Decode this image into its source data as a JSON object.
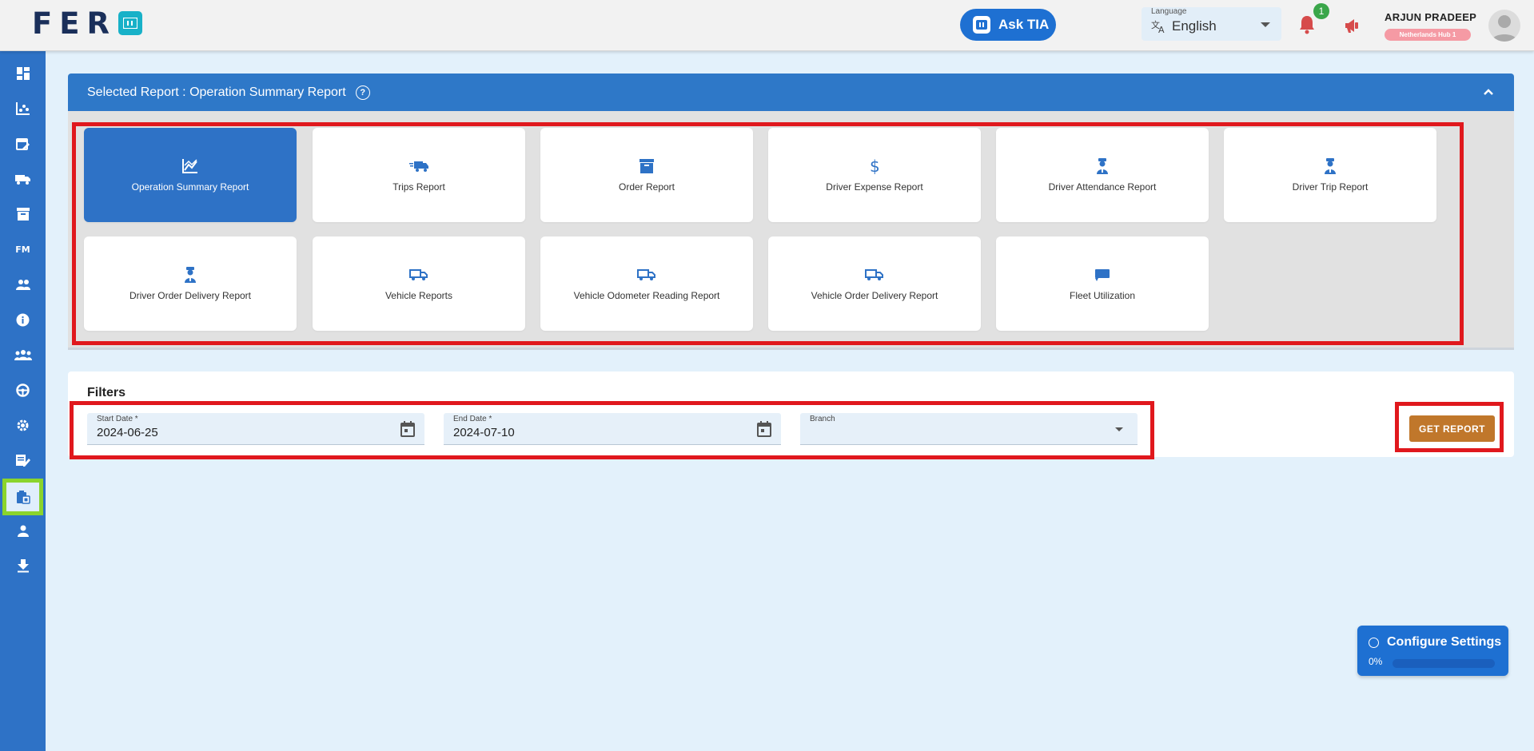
{
  "header": {
    "logo_text": "FER",
    "ask_label": "Ask TIA",
    "language_label": "Language",
    "language_value": "English",
    "notification_count": "1",
    "user_name": "ARJUN PRADEEP",
    "user_badge": "Netherlands Hub 1"
  },
  "sidebar": {
    "items": [
      {
        "icon": "dashboard-icon"
      },
      {
        "icon": "analytics-icon"
      },
      {
        "icon": "calendar-edit-icon"
      },
      {
        "icon": "truck-icon"
      },
      {
        "icon": "archive-icon"
      },
      {
        "icon": "fm-icon",
        "text": "FM"
      },
      {
        "icon": "group-icon"
      },
      {
        "icon": "info-icon"
      },
      {
        "icon": "team-icon"
      },
      {
        "icon": "steering-wheel-icon"
      },
      {
        "icon": "settings-icon"
      },
      {
        "icon": "edit-note-icon"
      },
      {
        "icon": "reports-icon",
        "active": true
      },
      {
        "icon": "driver-icon"
      },
      {
        "icon": "download-icon"
      }
    ]
  },
  "report_panel": {
    "title": "Selected Report : Operation Summary Report",
    "help": "?",
    "reports": [
      {
        "label": "Operation Summary Report",
        "icon": "chart-icon",
        "active": true
      },
      {
        "label": "Trips Report",
        "icon": "fast-truck-icon"
      },
      {
        "label": "Order Report",
        "icon": "archive-box-icon"
      },
      {
        "label": "Driver Expense Report",
        "icon": "dollar-icon"
      },
      {
        "label": "Driver Attendance Report",
        "icon": "driver-icon"
      },
      {
        "label": "Driver Trip Report",
        "icon": "driver-icon"
      },
      {
        "label": "Driver Order Delivery Report",
        "icon": "driver-icon"
      },
      {
        "label": "Vehicle Reports",
        "icon": "truck-outline-icon"
      },
      {
        "label": "Vehicle Odometer Reading Report",
        "icon": "truck-outline-icon"
      },
      {
        "label": "Vehicle Order Delivery Report",
        "icon": "truck-outline-icon"
      },
      {
        "label": "Fleet Utilization",
        "icon": "fleet-icon"
      }
    ]
  },
  "filters": {
    "title": "Filters",
    "start_date_label": "Start Date *",
    "start_date": "2024-06-25",
    "end_date_label": "End Date *",
    "end_date": "2024-07-10",
    "branch_label": "Branch",
    "branch_value": "",
    "get_report_label": "GET REPORT"
  },
  "config_widget": {
    "title": "Configure Settings",
    "progress_text": "0%",
    "progress": 0
  },
  "colors": {
    "primary": "#2e72c6",
    "highlight": "#e0181d",
    "active_sidebar_border": "#8bd42c",
    "get_report": "#c0772b"
  }
}
